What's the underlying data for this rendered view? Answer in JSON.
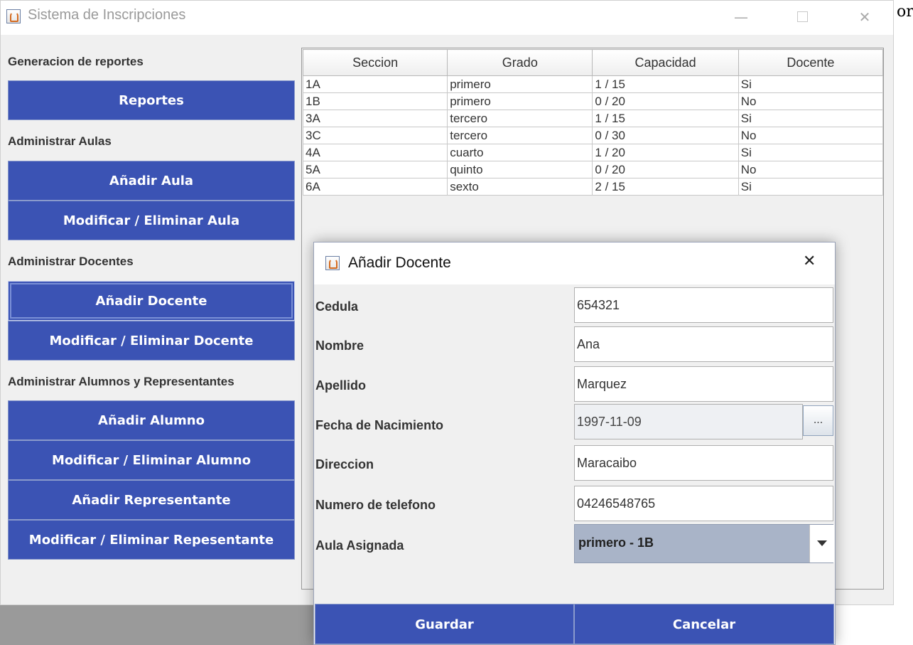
{
  "window": {
    "title": "Sistema de Inscripciones",
    "controls": {
      "minimize": "—",
      "close": "✕"
    }
  },
  "edge_text": "or",
  "sidebar": {
    "reports_label": "Generacion de reportes",
    "reports_button": "Reportes",
    "aulas_label": "Administrar Aulas",
    "add_aula": "Añadir Aula",
    "edit_aula": "Modificar / Eliminar Aula",
    "docentes_label": "Administrar Docentes",
    "add_docente": "Añadir Docente",
    "edit_docente": "Modificar / Eliminar Docente",
    "alumnos_label": "Administrar Alumnos y Representantes",
    "add_alumno": "Añadir Alumno",
    "edit_alumno": "Modificar / Eliminar Alumno",
    "add_representante": "Añadir Representante",
    "edit_representante": "Modificar / Eliminar Repesentante"
  },
  "table": {
    "headers": [
      "Seccion",
      "Grado",
      "Capacidad",
      "Docente"
    ],
    "rows": [
      [
        "1A",
        "primero",
        "1 / 15",
        "Si"
      ],
      [
        "1B",
        "primero",
        "0 / 20",
        "No"
      ],
      [
        "3A",
        "tercero",
        "1 / 15",
        "Si"
      ],
      [
        "3C",
        "tercero",
        "0 / 30",
        "No"
      ],
      [
        "4A",
        "cuarto",
        "1 / 20",
        "Si"
      ],
      [
        "5A",
        "quinto",
        "0 / 20",
        "No"
      ],
      [
        "6A",
        "sexto",
        "2 / 15",
        "Si"
      ]
    ]
  },
  "dialog": {
    "title": "Añadir Docente",
    "close": "✕",
    "fields": {
      "cedula": {
        "label": "Cedula",
        "value": "654321"
      },
      "nombre": {
        "label": "Nombre",
        "value": "Ana"
      },
      "apellido": {
        "label": "Apellido",
        "value": "Marquez"
      },
      "fecha": {
        "label": "Fecha de Nacimiento",
        "value": "1997-11-09",
        "button": "..."
      },
      "direccion": {
        "label": "Direccion",
        "value": "Maracaibo"
      },
      "telefono": {
        "label": "Numero de telefono",
        "value": "04246548765"
      },
      "aula": {
        "label": "Aula Asignada",
        "value": "primero - 1B"
      }
    },
    "save": "Guardar",
    "cancel": "Cancelar"
  },
  "colors": {
    "button_blue": "#3b53b4",
    "window_bg": "#f0f0f0",
    "select_bg": "#a9b4c8"
  }
}
